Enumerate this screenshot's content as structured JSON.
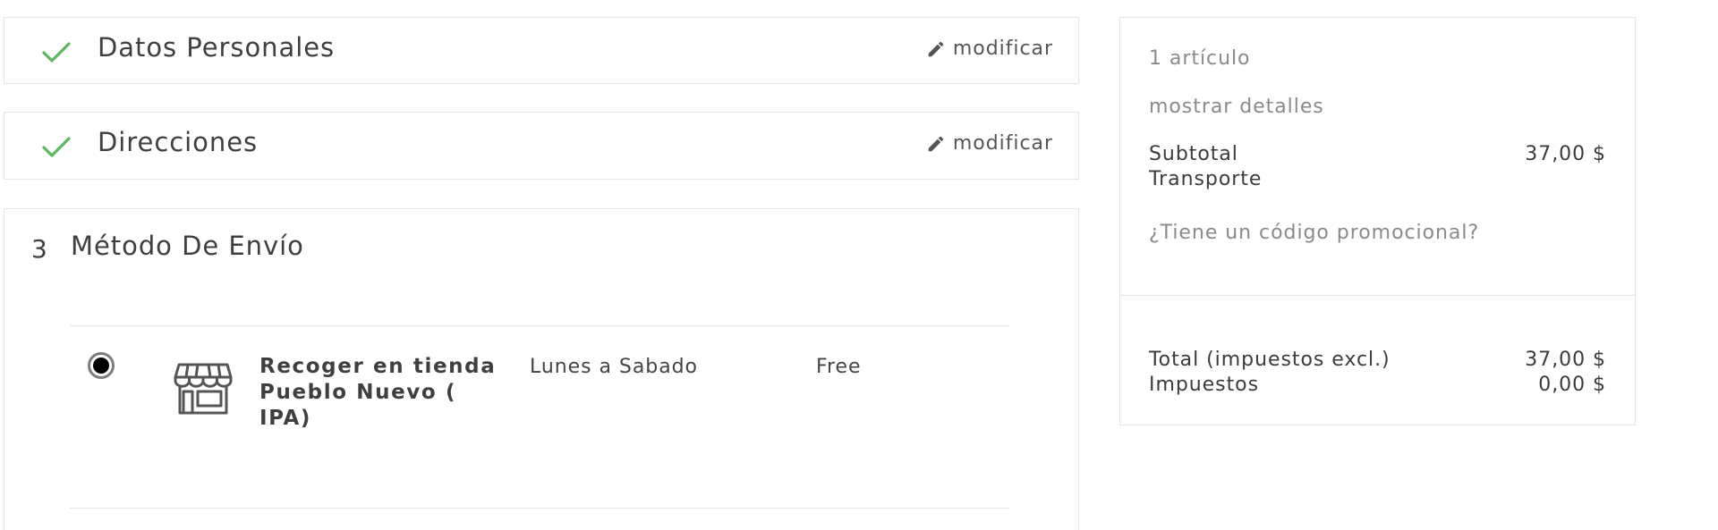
{
  "steps": {
    "personal": {
      "title": "Datos Personales",
      "edit_label": "modificar"
    },
    "addresses": {
      "title": "Direcciones",
      "edit_label": "modificar"
    },
    "shipping": {
      "number": "3",
      "title": "Método De Envío",
      "carrier": {
        "name": "Recoger en tienda Pueblo Nuevo ( IPA)",
        "delay": "Lunes a Sabado",
        "price": "Free"
      }
    }
  },
  "summary": {
    "items_count": "1 artículo",
    "show_details": "mostrar detalles",
    "subtotal_label": "Subtotal",
    "subtotal_value": "37,00 $",
    "shipping_label": "Transporte",
    "promo_link": "¿Tiene un código promocional?",
    "total_label": "Total (impuestos excl.)",
    "total_value": "37,00 $",
    "taxes_label": "Impuestos",
    "taxes_value": "0,00 $"
  },
  "colors": {
    "check": "#5cb85c",
    "border": "#e6e6e6",
    "muted_text": "#8a8a8a"
  },
  "icons": {
    "done": "check-icon",
    "edit": "pencil-icon",
    "carrier": "store-icon"
  }
}
